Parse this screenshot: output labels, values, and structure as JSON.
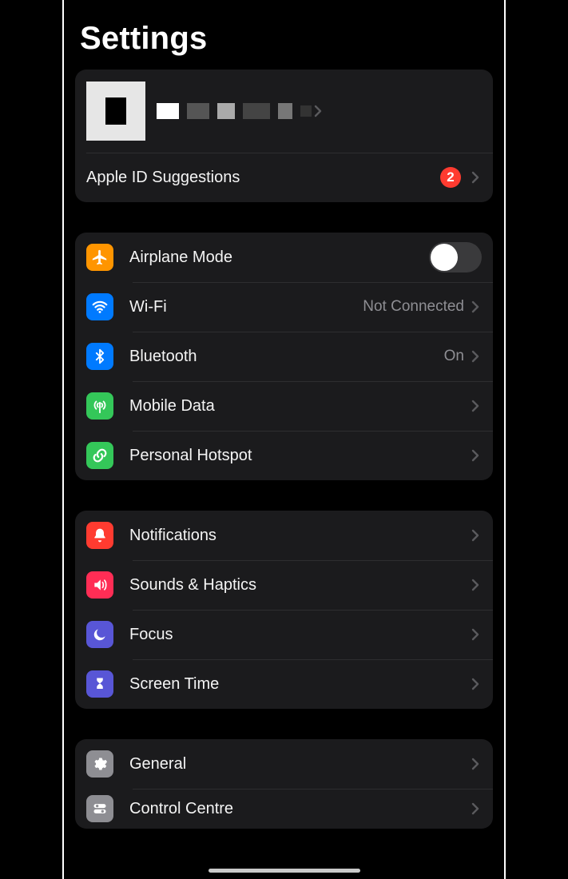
{
  "title": "Settings",
  "profile": {
    "appleIdSuggestionsLabel": "Apple ID Suggestions",
    "suggestionsBadge": "2"
  },
  "group1": {
    "airplane": {
      "label": "Airplane Mode",
      "on": false
    },
    "wifi": {
      "label": "Wi-Fi",
      "value": "Not Connected"
    },
    "bluetooth": {
      "label": "Bluetooth",
      "value": "On"
    },
    "mobile": {
      "label": "Mobile Data"
    },
    "hotspot": {
      "label": "Personal Hotspot"
    }
  },
  "group2": {
    "notifications": {
      "label": "Notifications"
    },
    "sounds": {
      "label": "Sounds & Haptics"
    },
    "focus": {
      "label": "Focus"
    },
    "screentime": {
      "label": "Screen Time"
    }
  },
  "group3": {
    "general": {
      "label": "General"
    },
    "controlcentre": {
      "label": "Control Centre"
    }
  }
}
